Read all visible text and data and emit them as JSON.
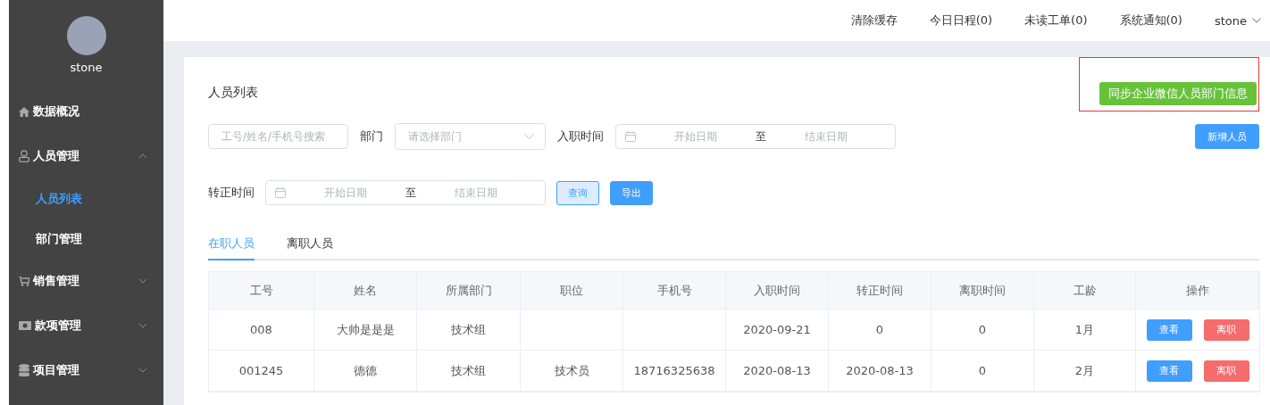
{
  "sidebar": {
    "user_name": "stone",
    "items": [
      {
        "kind": "home",
        "label": "数据概况",
        "selected": false
      },
      {
        "kind": "user",
        "label": "人员管理",
        "expanded": true,
        "selected": false,
        "children": [
          {
            "label": "人员列表",
            "selected": true
          },
          {
            "label": "部门管理",
            "selected": false
          }
        ]
      },
      {
        "kind": "cart",
        "label": "销售管理",
        "expanded": false,
        "selected": false
      },
      {
        "kind": "money",
        "label": "款项管理",
        "expanded": false,
        "selected": false
      },
      {
        "kind": "database",
        "label": "项目管理",
        "expanded": false,
        "selected": false
      }
    ]
  },
  "topbar": {
    "links": [
      "清除缓存",
      "今日日程(0)",
      "未读工单(0)",
      "系统通知(0)"
    ],
    "user": "stone"
  },
  "page": {
    "title": "人员列表",
    "sync_button": "同步企业微信人员部门信息",
    "add_button": "新增人员",
    "filters": {
      "search_placeholder": "工号/姓名/手机号搜索",
      "dept_label": "部门",
      "dept_placeholder": "请选择部门",
      "join_label": "入职时间",
      "join_start": "开始日期",
      "join_sep": "至",
      "join_end": "结束日期",
      "regular_label": "转正时间",
      "regular_start": "开始日期",
      "regular_sep": "至",
      "regular_end": "结束日期",
      "query_button": "查询",
      "export_button": "导出"
    },
    "tabs": [
      {
        "label": "在职人员",
        "selected": true
      },
      {
        "label": "离职人员",
        "selected": false
      }
    ],
    "table": {
      "columns": [
        "工号",
        "姓名",
        "所属部门",
        "职位",
        "手机号",
        "入职时间",
        "转正时间",
        "离职时间",
        "工龄",
        "操作"
      ],
      "rows": [
        {
          "cells": [
            "008",
            "大帅是是是",
            "技术组",
            "",
            "",
            "2020-09-21",
            "0",
            "0",
            "1月"
          ],
          "actions": [
            "查看",
            "离职"
          ]
        },
        {
          "cells": [
            "001245",
            "德德",
            "技术组",
            "技术员",
            "18716325638",
            "2020-08-13",
            "2020-08-13",
            "0",
            "2月"
          ],
          "actions": [
            "查看",
            "离职"
          ]
        }
      ]
    }
  }
}
